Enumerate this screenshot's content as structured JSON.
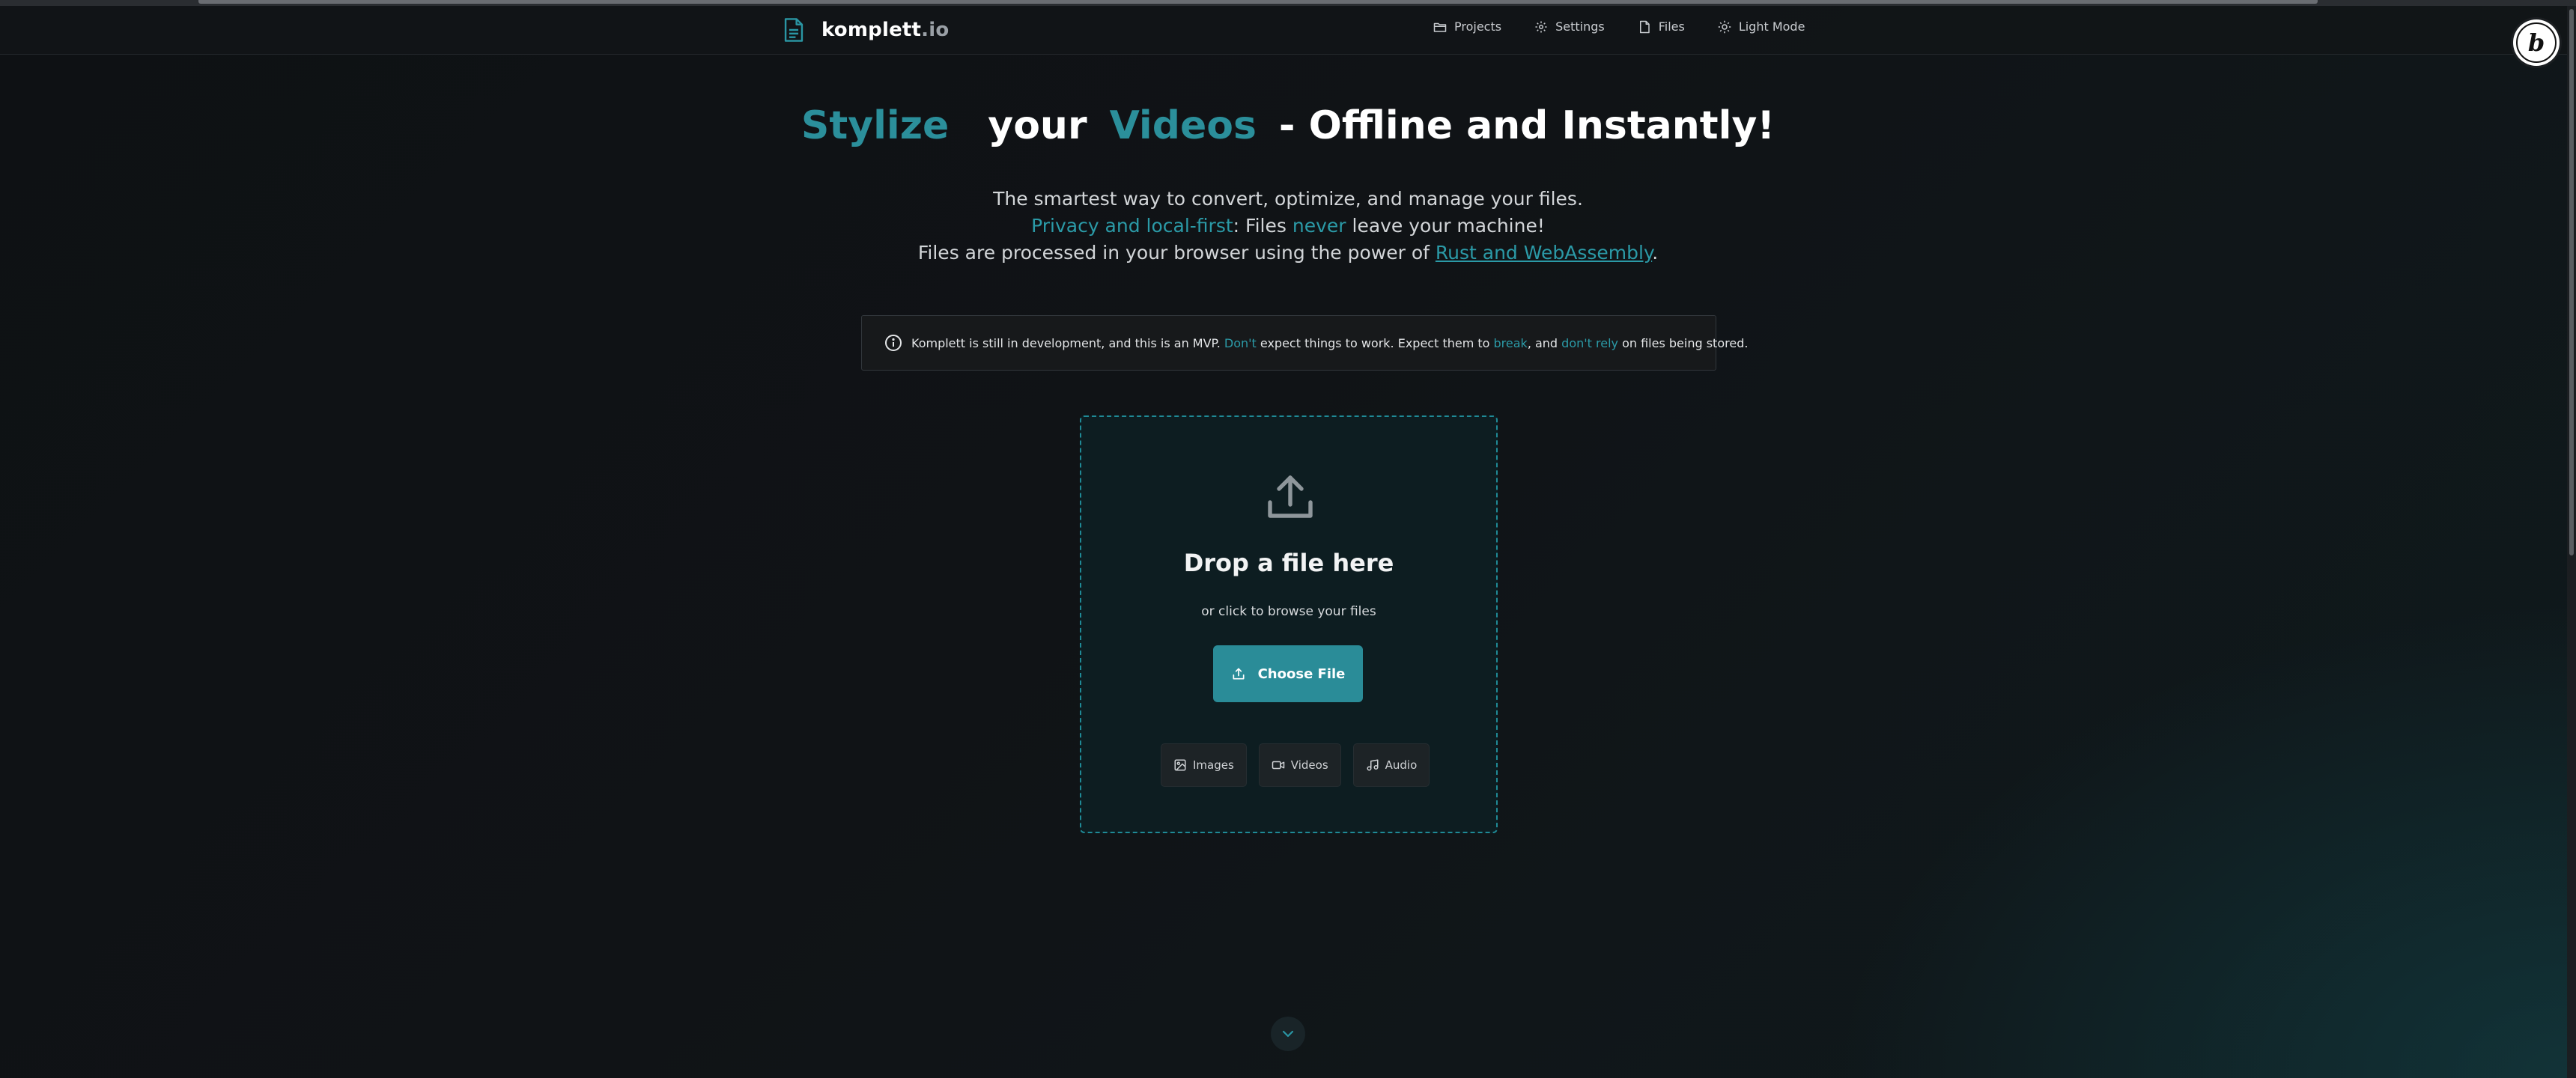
{
  "brand": {
    "name": "komplett",
    "tld": ".io",
    "icon": "file-text-icon"
  },
  "nav": {
    "items": [
      {
        "label": "Projects",
        "icon": "folder-icon"
      },
      {
        "label": "Settings",
        "icon": "gear-icon"
      },
      {
        "label": "Files",
        "icon": "file-icon"
      },
      {
        "label": "Light Mode",
        "icon": "sun-icon"
      }
    ]
  },
  "avatar": {
    "letter": "b"
  },
  "hero": {
    "word1": "Stylize",
    "word2": "your",
    "word3": "Videos",
    "rest": "- Offline and Instantly!"
  },
  "subtitle": {
    "line1": "The smartest way to convert, optimize, and manage your files.",
    "line2_accent1": "Privacy and local-first",
    "line2_text1": ": Files ",
    "line2_accent2": "never",
    "line2_text2": " leave your machine!",
    "line3_text": "Files are processed in your browser using the power of ",
    "line3_link": "Rust and WebAssembly",
    "line3_end": "."
  },
  "notice": {
    "part1": "Komplett is still in development, and this is an MVP. ",
    "accent1": "Don't",
    "part2": " expect things to work. Expect them to ",
    "accent2": "break",
    "part3": ", and ",
    "accent3": "don't rely",
    "part4": " on files being stored."
  },
  "dropzone": {
    "title": "Drop a file here",
    "subtitle": "or click to browse your files",
    "button_label": "Choose File",
    "types": [
      {
        "label": "Images",
        "icon": "image-icon"
      },
      {
        "label": "Videos",
        "icon": "video-icon"
      },
      {
        "label": "Audio",
        "icon": "music-icon"
      }
    ]
  },
  "colors": {
    "accent": "#2b8f9b",
    "background": "#101316",
    "dropzone_border": "#1f8a96",
    "button": "#2a8c98"
  }
}
